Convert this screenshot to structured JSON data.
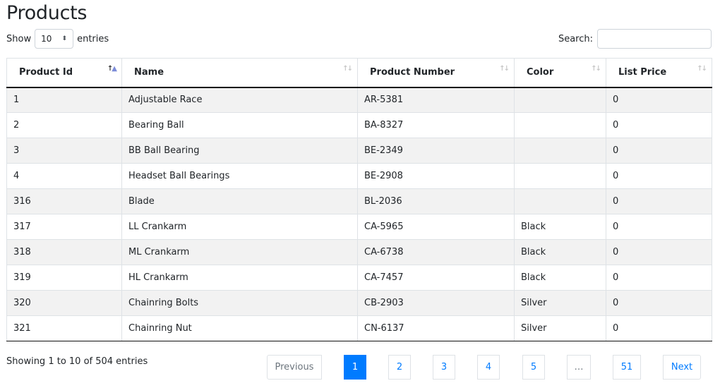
{
  "page": {
    "title": "Products"
  },
  "length_control": {
    "prefix": "Show",
    "selected": "10",
    "suffix": "entries",
    "arrows_icon": "⬍"
  },
  "search": {
    "label": "Search:",
    "value": "",
    "placeholder": ""
  },
  "table": {
    "columns": [
      {
        "label": "Product Id",
        "sort": "ascending"
      },
      {
        "label": "Name",
        "sort": "none"
      },
      {
        "label": "Product Number",
        "sort": "none"
      },
      {
        "label": "Color",
        "sort": "none"
      },
      {
        "label": "List Price",
        "sort": "none"
      }
    ],
    "rows": [
      {
        "id": "1",
        "name": "Adjustable Race",
        "number": "AR-5381",
        "color": "",
        "price": "0"
      },
      {
        "id": "2",
        "name": "Bearing Ball",
        "number": "BA-8327",
        "color": "",
        "price": "0"
      },
      {
        "id": "3",
        "name": "BB Ball Bearing",
        "number": "BE-2349",
        "color": "",
        "price": "0"
      },
      {
        "id": "4",
        "name": "Headset Ball Bearings",
        "number": "BE-2908",
        "color": "",
        "price": "0"
      },
      {
        "id": "316",
        "name": "Blade",
        "number": "BL-2036",
        "color": "",
        "price": "0"
      },
      {
        "id": "317",
        "name": "LL Crankarm",
        "number": "CA-5965",
        "color": "Black",
        "price": "0"
      },
      {
        "id": "318",
        "name": "ML Crankarm",
        "number": "CA-6738",
        "color": "Black",
        "price": "0"
      },
      {
        "id": "319",
        "name": "HL Crankarm",
        "number": "CA-7457",
        "color": "Black",
        "price": "0"
      },
      {
        "id": "320",
        "name": "Chainring Bolts",
        "number": "CB-2903",
        "color": "Silver",
        "price": "0"
      },
      {
        "id": "321",
        "name": "Chainring Nut",
        "number": "CN-6137",
        "color": "Silver",
        "price": "0"
      }
    ]
  },
  "info": "Showing 1 to 10 of 504 entries",
  "pagination": {
    "previous": "Previous",
    "pages": [
      "1",
      "2",
      "3",
      "4",
      "5",
      "…",
      "51"
    ],
    "current": "1",
    "next": "Next"
  },
  "colors": {
    "accent": "#007bff",
    "stripe": "#f2f2f2",
    "border": "#dee2e6"
  }
}
